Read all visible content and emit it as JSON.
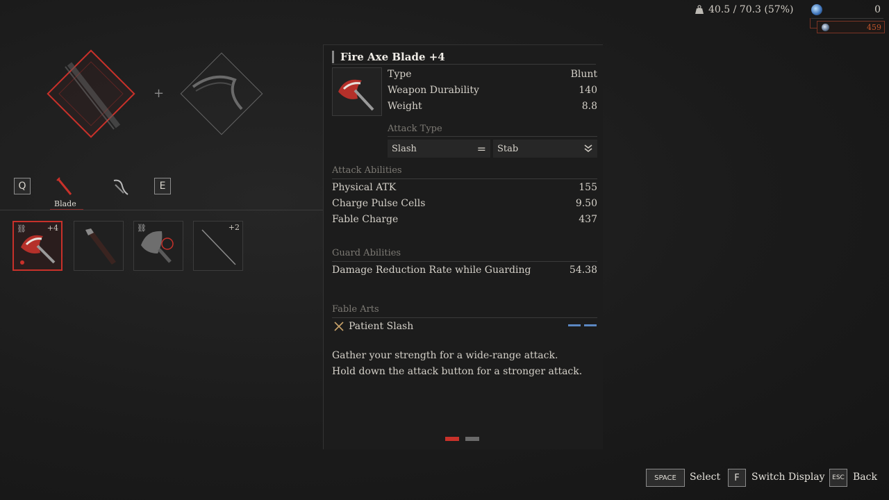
{
  "header": {
    "weight_text": "40.5 / 70.3 (57%)",
    "currency_primary": "0",
    "currency_secondary": "459"
  },
  "left": {
    "plus": "+",
    "key_prev": "Q",
    "key_next": "E",
    "active_tab_label": "Blade",
    "slots": [
      {
        "badge": "+4",
        "linked": true,
        "selected": true
      },
      {
        "badge": "",
        "linked": false,
        "selected": false
      },
      {
        "badge": "",
        "linked": true,
        "selected": false
      },
      {
        "badge": "+2",
        "linked": false,
        "selected": false
      }
    ]
  },
  "detail": {
    "title": "Fire Axe Blade +4",
    "stats": [
      {
        "label": "Type",
        "value": "Blunt"
      },
      {
        "label": "Weapon Durability",
        "value": "140"
      },
      {
        "label": "Weight",
        "value": "8.8"
      }
    ],
    "attack_type_heading": "Attack Type",
    "attack_type_primary": "Slash",
    "attack_type_equals": "=",
    "attack_type_secondary": "Stab",
    "attack_abilities_heading": "Attack Abilities",
    "attack_abilities": [
      {
        "label": "Physical ATK",
        "value": "155"
      },
      {
        "label": "Charge Pulse Cells",
        "value": "9.50"
      },
      {
        "label": "Fable Charge",
        "value": "437"
      }
    ],
    "guard_abilities_heading": "Guard Abilities",
    "guard_abilities": [
      {
        "label": "Damage Reduction Rate while Guarding",
        "value": "54.38"
      }
    ],
    "fable_arts_heading": "Fable Arts",
    "fable_art_name": "Patient Slash",
    "description_line1": "Gather your strength for a wide-range attack.",
    "description_line2": "Hold down the attack button for a stronger attack.",
    "page_index": 1,
    "page_count": 2
  },
  "footer": {
    "select_key": "SPACE",
    "select_label": "Select",
    "switch_key": "F",
    "switch_label": "Switch Display",
    "back_key": "ESC",
    "back_label": "Back"
  },
  "colors": {
    "accent_red": "#c8312a",
    "fable_bar_blue": "#5b87c2",
    "currency_orange": "#c2562c"
  }
}
